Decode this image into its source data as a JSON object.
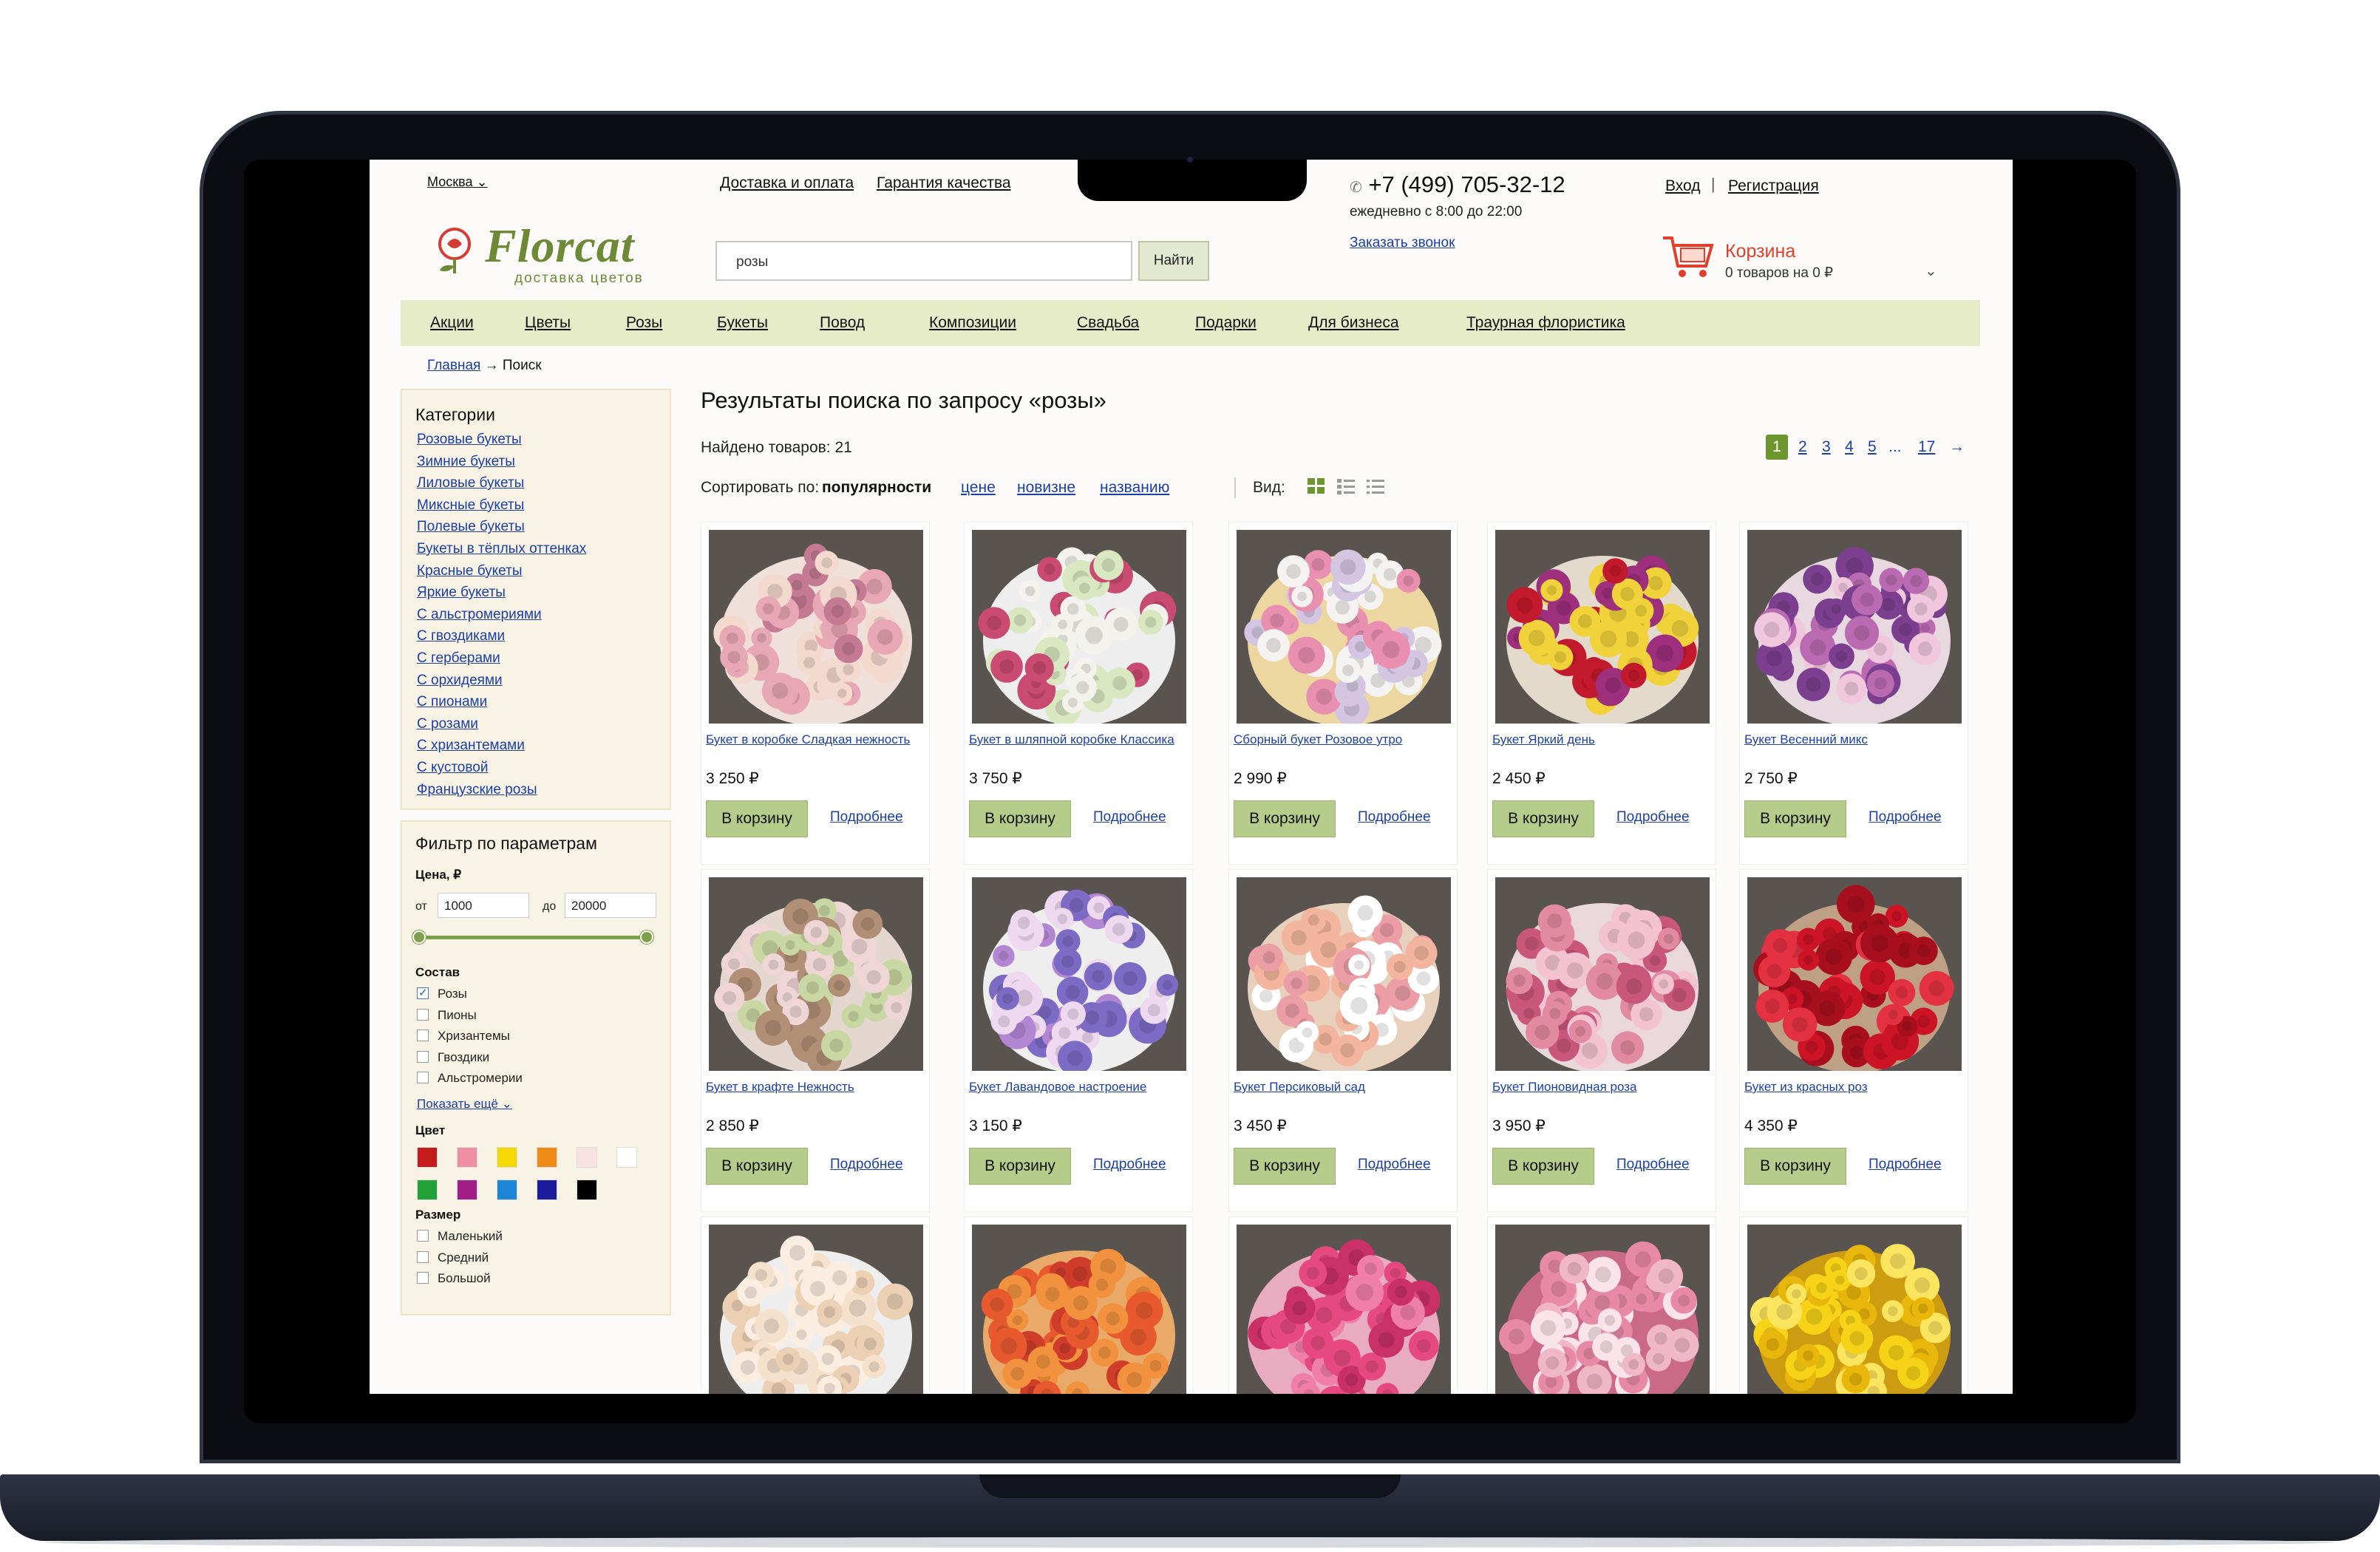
{
  "header": {
    "city": "Москва",
    "top_links": [
      "Доставка и оплата",
      "Гарантия качества"
    ],
    "logo_word": "Florcat",
    "logo_tagline": "доставка цветов",
    "search_value": "розы",
    "search_button": "Найти",
    "phone": "+7 (499) 705-32-12",
    "hours": "ежедневно с 8:00 до 22:00",
    "callback": "Заказать звонок",
    "login": "Вход",
    "separator": "|",
    "register": "Регистрация",
    "cart_title": "Корзина",
    "cart_summary": "0 товаров на 0 ₽"
  },
  "nav": [
    "Акции",
    "Цветы",
    "Розы",
    "Букеты",
    "Повод",
    "Композиции",
    "Свадьба",
    "Подарки",
    "Для бизнеса",
    "Траурная флористика"
  ],
  "breadcrumb": {
    "home": "Главная",
    "arrow": "→",
    "current": "Поиск"
  },
  "sidebar": {
    "categories_title": "Категории",
    "categories": [
      "Розовые букеты",
      "Зимние букеты",
      "Лиловые букеты",
      "Миксные букеты",
      "Полевые букеты",
      "Букеты в тёплых оттенках",
      "Красные букеты",
      "Яркие букеты",
      "С альстромериями",
      "С гвоздиками",
      "С герберами",
      "С орхидеями",
      "С пионами",
      "С розами",
      "С хризантемами",
      "С кустовой",
      "Французские розы"
    ],
    "filter_title": "Фильтр по параметрам",
    "price_label": "Цена, ₽",
    "price_from_label": "от",
    "price_from": "1000",
    "price_to_label": "до",
    "price_to": "20000",
    "composition_label": "Состав",
    "composition": [
      {
        "label": "Розы",
        "checked": true
      },
      {
        "label": "Пионы",
        "checked": false
      },
      {
        "label": "Хризантемы",
        "checked": false
      },
      {
        "label": "Гвоздики",
        "checked": false
      },
      {
        "label": "Альстромерии",
        "checked": false
      }
    ],
    "show_more": "Показать ещё",
    "color_label": "Цвет",
    "colors": [
      "#c41b1b",
      "#ee8fa4",
      "#f5d800",
      "#f08a16",
      "#f8e2e2",
      "#ffffff",
      "#23a23a",
      "#a21d86",
      "#1e86d6",
      "#1c1c9c",
      "#000000"
    ],
    "size_label": "Размер",
    "sizes": [
      "Маленький",
      "Средний",
      "Большой"
    ]
  },
  "results": {
    "title": "Результаты поиска по запросу «розы»",
    "found": "Найдено товаров: 21",
    "sort_label": "Сортировать по:",
    "sort_active": "популярности",
    "sort_options": [
      "цене",
      "новизне",
      "названию"
    ],
    "view_label": "Вид:",
    "pages": [
      "1",
      "2",
      "3",
      "4",
      "5",
      "...",
      "17",
      "→"
    ],
    "current_page": "1",
    "buy_label": "В корзину",
    "more_label": "Подробнее"
  },
  "products": [
    {
      "name": "Букет в коробке Сладкая нежность",
      "price": "3 250 ₽",
      "palette": [
        "#e7a7b4",
        "#f4d9cf",
        "#c57a93",
        "#fff1e8"
      ]
    },
    {
      "name": "Букет в шляпной коробке Классика",
      "price": "3 750 ₽",
      "palette": [
        "#f3f2ec",
        "#c94b72",
        "#d9e8c0",
        "#ffffff"
      ]
    },
    {
      "name": "Сборный букет Розовое утро",
      "price": "2 990 ₽",
      "palette": [
        "#f5f3f2",
        "#e98fb0",
        "#d4c6e3",
        "#fce5a8"
      ]
    },
    {
      "name": "Букет Яркий день",
      "price": "2 450 ₽",
      "palette": [
        "#c3192c",
        "#f1d23a",
        "#9d2f7c",
        "#f3e9d9"
      ]
    },
    {
      "name": "Букет Весенний микс",
      "price": "2 750 ₽",
      "palette": [
        "#b96ab0",
        "#f0c7dc",
        "#7c3f8f",
        "#f7e7ef"
      ]
    },
    {
      "name": "Букет в крафте Нежность",
      "price": "2 850 ₽",
      "palette": [
        "#c9d7a2",
        "#efd5d6",
        "#b08f76",
        "#f2e6dd"
      ]
    },
    {
      "name": "Букет Лавандовое настроение",
      "price": "3 150 ₽",
      "palette": [
        "#7b6bc4",
        "#efd9f0",
        "#b386d4",
        "#ffffff"
      ]
    },
    {
      "name": "Букет Персиковый сад",
      "price": "3 450 ₽",
      "palette": [
        "#f3b59d",
        "#ffffff",
        "#ec9ea6",
        "#f6dfc9"
      ]
    },
    {
      "name": "Букет Пионовидная роза",
      "price": "3 950 ₽",
      "palette": [
        "#e28aa1",
        "#f3c3cf",
        "#c95779",
        "#fae5ea"
      ]
    },
    {
      "name": "Букет из красных роз",
      "price": "4 350 ₽",
      "palette": [
        "#cc1426",
        "#a80f1e",
        "#e43141",
        "#c9a98a"
      ]
    },
    {
      "name": "",
      "price": "",
      "palette": [
        "#f6e2cc",
        "#fbeee0",
        "#ecd0b4",
        "#ffffff"
      ]
    },
    {
      "name": "",
      "price": "",
      "palette": [
        "#e85a2e",
        "#f2923f",
        "#cf3d2a",
        "#f7b36c"
      ]
    },
    {
      "name": "",
      "price": "",
      "palette": [
        "#e6497f",
        "#f07fa8",
        "#c93066",
        "#f7b5cb"
      ]
    },
    {
      "name": "",
      "price": "",
      "palette": [
        "#f0b7c6",
        "#e889a8",
        "#fbe3ea",
        "#d66d8e"
      ]
    },
    {
      "name": "",
      "price": "",
      "palette": [
        "#f6d317",
        "#e9b60b",
        "#fbe45e",
        "#d9a409"
      ]
    }
  ]
}
